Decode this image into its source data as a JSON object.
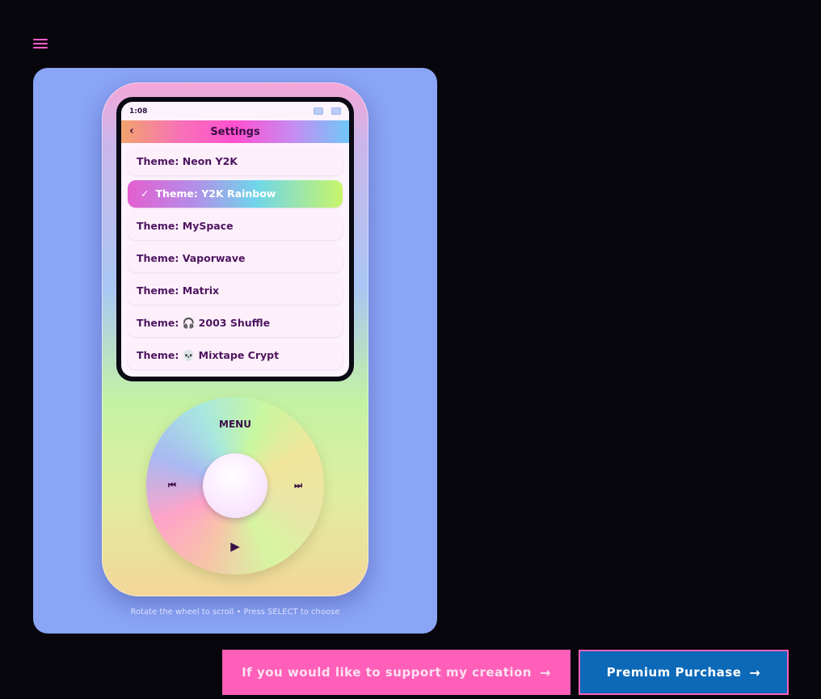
{
  "header": {
    "menu_icon": "hamburger-icon"
  },
  "device": {
    "status": {
      "time": "1:08"
    },
    "title": "Settings",
    "back_icon": "‹",
    "themes": [
      {
        "label": "Theme: Neon Y2K",
        "selected": false
      },
      {
        "label": "Theme: Y2K Rainbow",
        "selected": true
      },
      {
        "label": "Theme: MySpace",
        "selected": false
      },
      {
        "label": "Theme: Vaporwave",
        "selected": false
      },
      {
        "label": "Theme: Matrix",
        "selected": false
      },
      {
        "label": "Theme: 🎧 2003 Shuffle",
        "selected": false
      },
      {
        "label": "Theme: 💀 Mixtape Crypt",
        "selected": false
      }
    ],
    "check_mark": "✓",
    "wheel": {
      "menu_label": "MENU",
      "prev_glyph": "⏮",
      "next_glyph": "⏭",
      "play_glyph": "▶"
    }
  },
  "hint": "Rotate the wheel to scroll • Press SELECT to choose",
  "buttons": {
    "support_label": "If you would like to support my creation",
    "premium_label": "Premium Purchase",
    "arrow": "→"
  },
  "colors": {
    "page_bg": "#07060c",
    "panel_bg": "#8aa4f6",
    "accent_pink": "#ff5fb8",
    "premium_blue": "#0b69b8",
    "text_dark": "#4d1560"
  }
}
